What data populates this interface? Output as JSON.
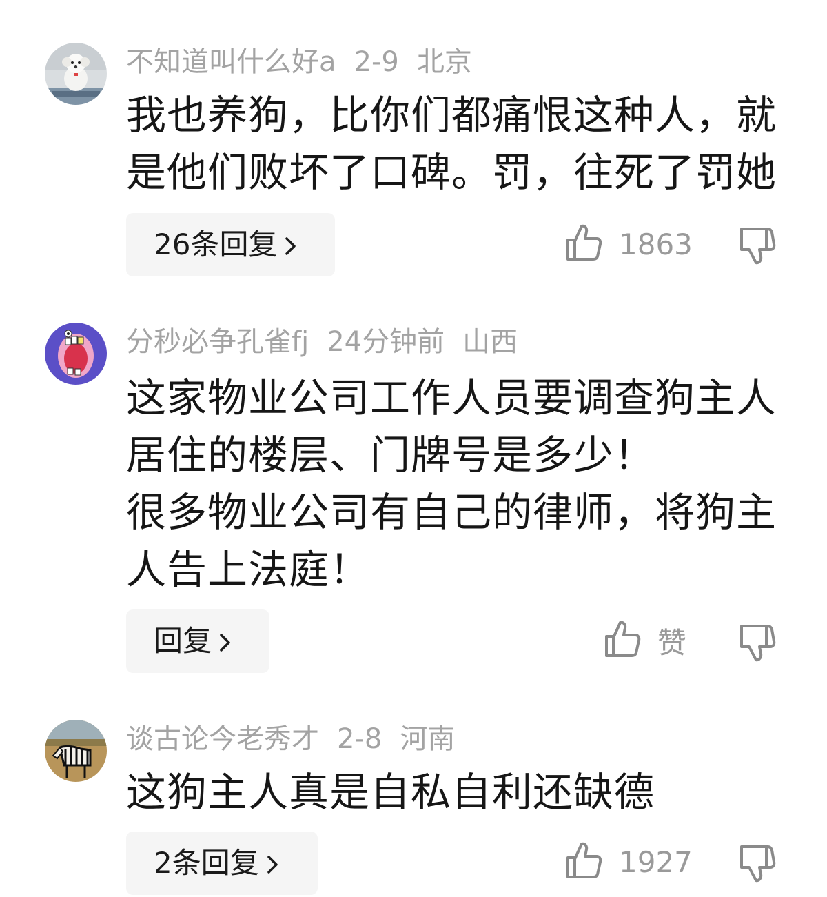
{
  "comments": [
    {
      "username": "不知道叫什么好a",
      "date": "2-9",
      "location": "北京",
      "text": "我也养狗，比你们都痛恨这种人，就\n是他们败坏了口碑。罚，往死了罚她",
      "reply_label": "26条回复",
      "like_count": "1863"
    },
    {
      "username": "分秒必争孔雀fj",
      "date": "24分钟前",
      "location": "山西",
      "text": "这家物业公司工作人员要调查狗主人\n居住的楼层、门牌号是多少！\n很多物业公司有自己的律师，将狗主\n人告上法庭！",
      "reply_label": "回复",
      "like_count": "赞"
    },
    {
      "username": "谈古论今老秀才",
      "date": "2-8",
      "location": "河南",
      "text": "这狗主人真是自私自利还缺德",
      "reply_label": "2条回复",
      "like_count": "1927"
    }
  ],
  "colors": {
    "meta_text": "#a3a3a3",
    "reply_bg": "#f5f5f5",
    "icon": "#8a8a8a"
  },
  "icons": [
    "thumbs-up-icon",
    "thumbs-down-icon",
    "chevron-right-icon"
  ]
}
